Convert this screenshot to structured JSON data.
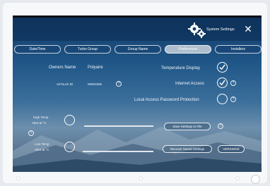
{
  "header": {
    "title": "System Settings",
    "close_label": "✕"
  },
  "tabs": [
    {
      "label": "Date/Time",
      "active": false
    },
    {
      "label": "Turbo Group",
      "active": false
    },
    {
      "label": "Group Name",
      "active": false
    },
    {
      "label": "Preferences",
      "active": true
    },
    {
      "label": "Installers",
      "active": false
    }
  ],
  "owner": {
    "label": "Owners Name",
    "value": "Polyaire"
  },
  "airtouch": {
    "label": "AirTouch ID",
    "value": "00061805"
  },
  "options": {
    "temperature_display": {
      "label": "Temperature Display",
      "checked": true
    },
    "internet_access": {
      "label": "Internet Access",
      "checked": true
    },
    "local_password": {
      "label": "Local Access Password Protection",
      "checked": false
    }
  },
  "alerts": {
    "high_label_1": "High Temp",
    "high_label_2": "Alert at °C",
    "low_label_1": "Low Temp",
    "low_label_2": "Alert at °C"
  },
  "buttons": {
    "save_to_file": "Save Settings to File",
    "recover_saved": "Recover Saved Settings",
    "versions": "VERSIONS"
  },
  "info_glyph": "?",
  "colors": {
    "header_bg": "#0b2b52",
    "accent": "#ffffff"
  }
}
